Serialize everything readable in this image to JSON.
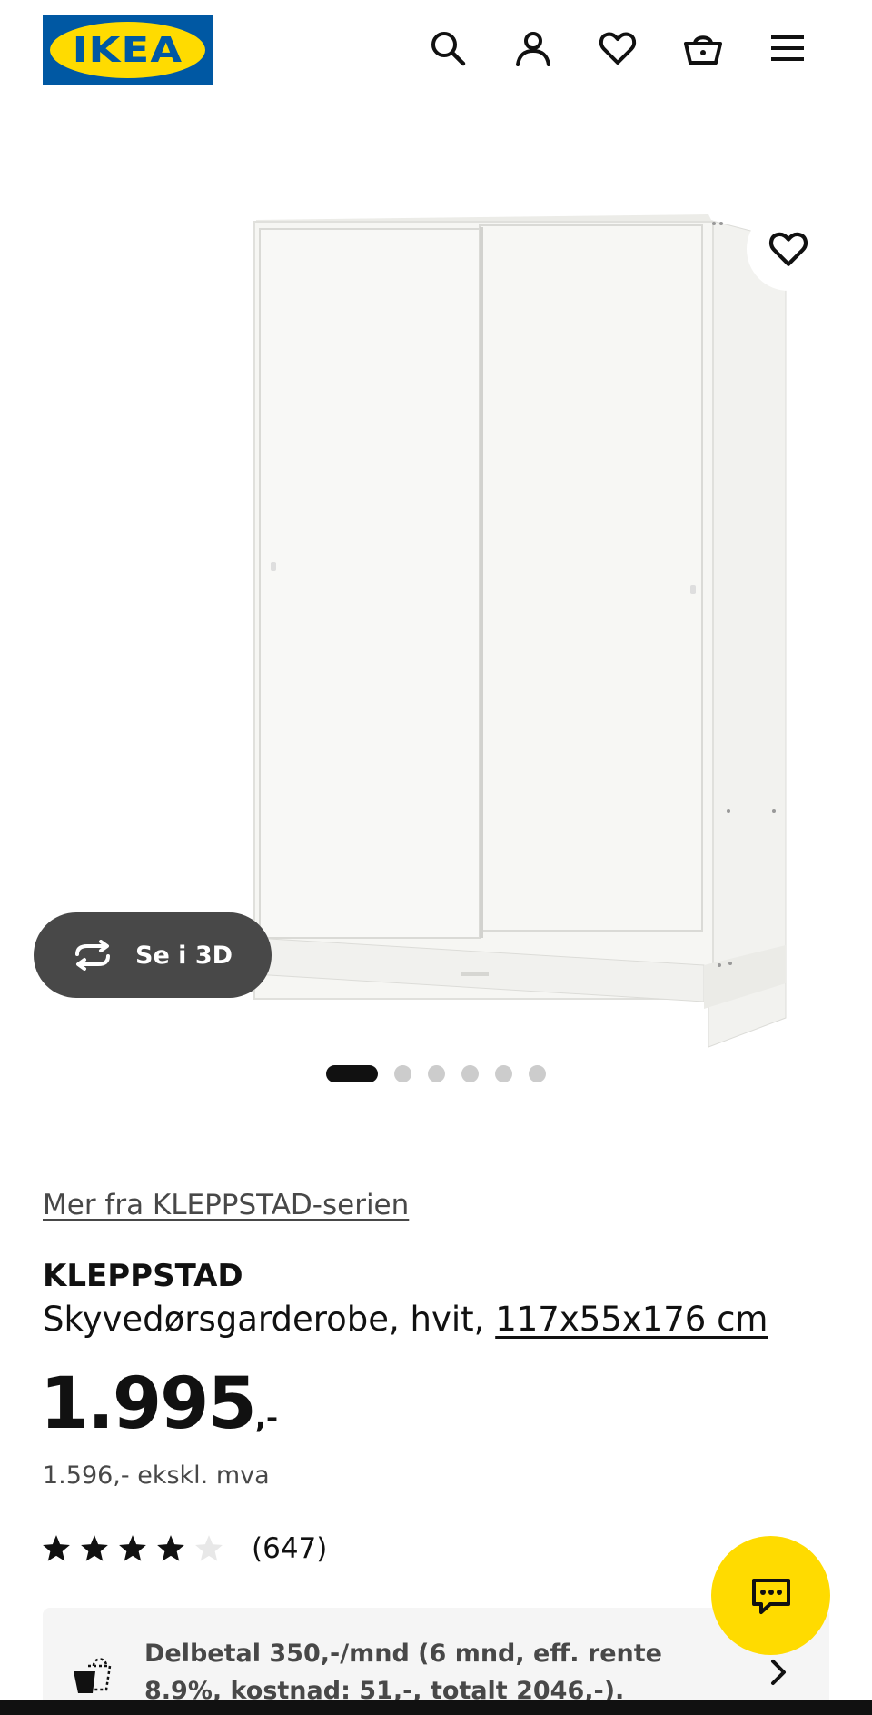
{
  "header": {
    "logo_text": "IKEA",
    "icons": [
      "search-icon",
      "user-icon",
      "heart-icon",
      "basket-icon",
      "menu-icon"
    ]
  },
  "gallery": {
    "view_3d_label": "Se i 3D",
    "slide_count": 6,
    "active_slide": 1
  },
  "product": {
    "series_link": "Mer fra KLEPPSTAD-serien",
    "name": "KLEPPSTAD",
    "description": "Skyvedørsgarderobe, hvit, ",
    "dimensions": "117x55x176 cm",
    "price_integer": "1.995",
    "price_decimal": ",-",
    "price_ex_vat": "1.596,- ekskl. mva",
    "rating_value": 4,
    "rating_max": 5,
    "rating_count": "(647)"
  },
  "finance": {
    "text": "Delbetal 350,-/mnd (6 mnd, eff. rente 8.9%, kostnad: 51,-, totalt 2046,-)."
  },
  "colors": {
    "ikea_blue": "#0058a3",
    "ikea_yellow": "#ffdb00",
    "dark_button": "#484848"
  }
}
